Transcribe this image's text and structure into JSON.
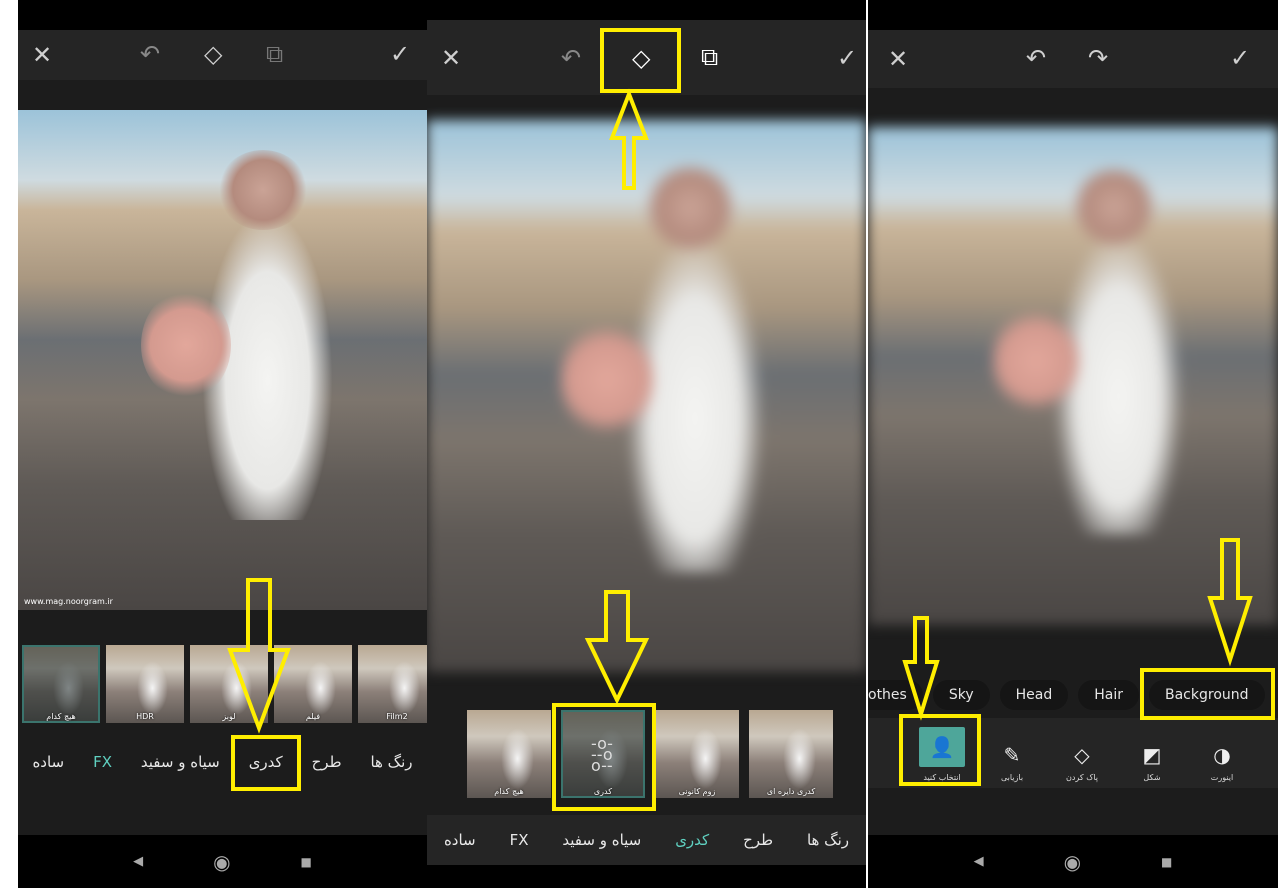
{
  "panel1": {
    "toolbar": {
      "close": "✕",
      "undo": "↶",
      "eraser": "◇",
      "compare": "⧉",
      "apply": "✓"
    },
    "watermark": "www.mag.noorgram.ir",
    "thumbnails": [
      {
        "label": "هیچ کدام",
        "selected": true
      },
      {
        "label": "HDR"
      },
      {
        "label": "لوبز"
      },
      {
        "label": "فیلم"
      },
      {
        "label": "Film2"
      }
    ],
    "tabs": [
      {
        "label": "رنگ ها"
      },
      {
        "label": "طرح"
      },
      {
        "label": "کدری",
        "highlighted": true
      },
      {
        "label": "سیاه و سفید"
      },
      {
        "label": "FX",
        "active": true
      },
      {
        "label": "ساده"
      }
    ]
  },
  "panel2": {
    "toolbar": {
      "close": "✕",
      "undo": "↶",
      "eraser": "◇",
      "compare": "⧉",
      "apply": "✓"
    },
    "thumbnails": [
      {
        "label": "هیچ کدام"
      },
      {
        "label": "کدری",
        "selected": true,
        "icon": "sliders-icon"
      },
      {
        "label": "زوم کانونی"
      },
      {
        "label": "کدری دایره ای"
      }
    ],
    "tabs": [
      {
        "label": "رنگ ها"
      },
      {
        "label": "طرح"
      },
      {
        "label": "کدری",
        "active": true
      },
      {
        "label": "سیاه و سفید"
      },
      {
        "label": "FX"
      },
      {
        "label": "ساده"
      }
    ]
  },
  "panel3": {
    "toolbar": {
      "close": "✕",
      "undo": "↶",
      "redo": "↷",
      "apply": "✓"
    },
    "chips": [
      "othes",
      "Sky",
      "Head",
      "Hair",
      "Background"
    ],
    "tools": [
      {
        "label": "انتخاب کنید",
        "icon": "person-select-icon",
        "selected": true
      },
      {
        "label": "بازیابی",
        "icon": "brush-icon"
      },
      {
        "label": "پاک کردن",
        "icon": "eraser-icon"
      },
      {
        "label": "شکل",
        "icon": "shape-icon"
      },
      {
        "label": "اینورت",
        "icon": "invert-icon"
      }
    ]
  },
  "nav": {
    "back": "◀",
    "home": "◉",
    "recents": "■"
  },
  "colors": {
    "accent": "#5fd0c0",
    "annotation": "#ffee00",
    "toolbar": "#252525"
  }
}
